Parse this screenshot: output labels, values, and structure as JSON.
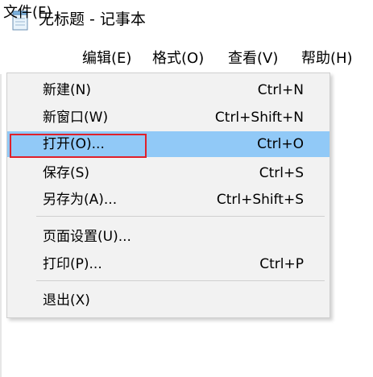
{
  "window": {
    "title": "无标题 - 记事本",
    "icon": "notepad-icon"
  },
  "menubar": {
    "file": "文件(F)",
    "edit": "编辑(E)",
    "format": "格式(O)",
    "view": "查看(V)",
    "help": "帮助(H)"
  },
  "file_menu": {
    "items": [
      {
        "label": "新建(N)",
        "shortcut": "Ctrl+N"
      },
      {
        "label": "新窗口(W)",
        "shortcut": "Ctrl+Shift+N"
      },
      {
        "label": "打开(O)...",
        "shortcut": "Ctrl+O",
        "highlighted": true
      },
      {
        "label": "保存(S)",
        "shortcut": "Ctrl+S"
      },
      {
        "label": "另存为(A)...",
        "shortcut": "Ctrl+Shift+S"
      },
      {
        "label": "页面设置(U)...",
        "shortcut": ""
      },
      {
        "label": "打印(P)...",
        "shortcut": "Ctrl+P"
      },
      {
        "label": "退出(X)",
        "shortcut": ""
      }
    ]
  },
  "colors": {
    "highlight": "#91c9f7",
    "annotation_border": "#e0202a",
    "menu_bg": "#f2f2f2"
  }
}
